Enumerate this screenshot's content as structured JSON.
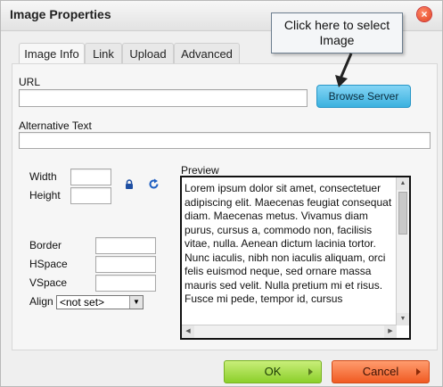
{
  "dialog": {
    "title": "Image Properties",
    "close_symbol": "×"
  },
  "callout": {
    "line1": "Click here to select",
    "line2": "Image"
  },
  "tabs": [
    {
      "label": "Image Info",
      "active": true
    },
    {
      "label": "Link",
      "active": false
    },
    {
      "label": "Upload",
      "active": false
    },
    {
      "label": "Advanced",
      "active": false
    }
  ],
  "fields": {
    "url_label": "URL",
    "url_value": "",
    "browse_label": "Browse Server",
    "alt_label": "Alternative Text",
    "alt_value": "",
    "width_label": "Width",
    "width_value": "",
    "height_label": "Height",
    "height_value": "",
    "border_label": "Border",
    "hspace_label": "HSpace",
    "vspace_label": "VSpace",
    "align_label": "Align",
    "align_value": "<not set>"
  },
  "preview": {
    "label": "Preview",
    "text": "Lorem ipsum dolor sit amet, consectetuer adipiscing elit. Maecenas feugiat consequat diam. Maecenas metus. Vivamus diam purus, cursus a, commodo non, facilisis vitae, nulla. Aenean dictum lacinia tortor. Nunc iaculis, nibh non iaculis aliquam, orci felis euismod neque, sed ornare massa mauris sed velit. Nulla pretium mi et risus. Fusce mi pede, tempor id, cursus"
  },
  "footer": {
    "ok_label": "OK",
    "cancel_label": "Cancel"
  },
  "colors": {
    "browse": "#3ab1df",
    "ok": "#8bcf2a",
    "cancel": "#f05a22",
    "close": "#e0401e"
  },
  "icons": [
    "lock-icon",
    "reset-size-icon",
    "arrow-pointer-icon",
    "close-icon"
  ]
}
